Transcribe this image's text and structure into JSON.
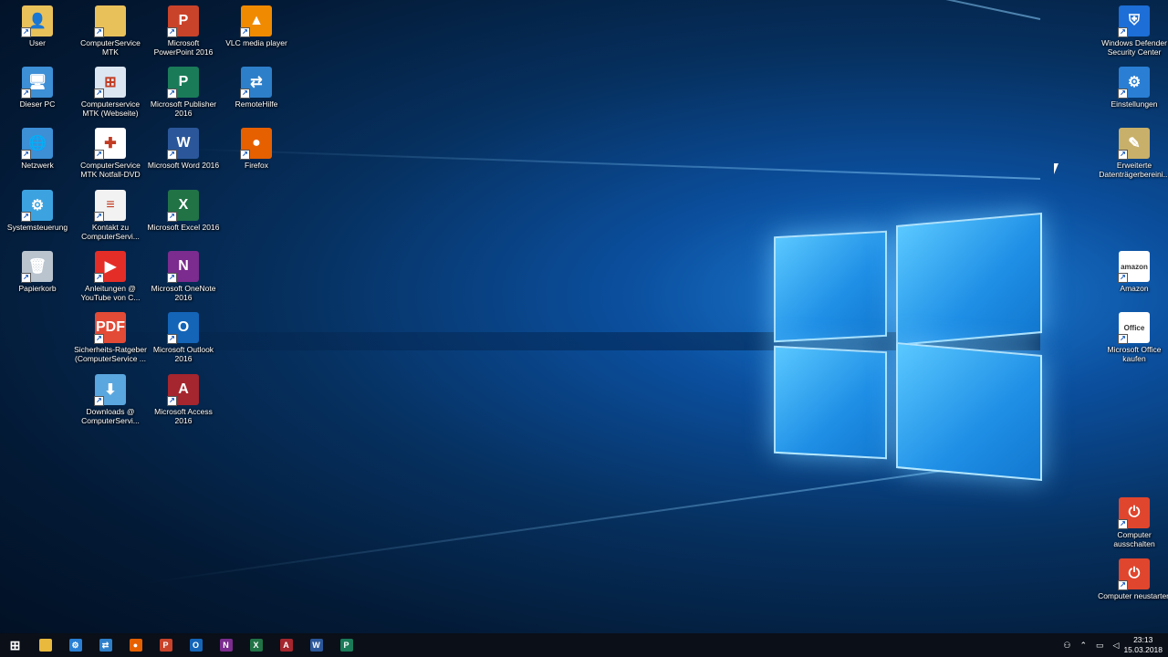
{
  "desktop_left": [
    {
      "label": "User",
      "icon": "user-folder-icon",
      "color": "#e9c15b",
      "glyph": "👤"
    },
    {
      "label": "Dieser PC",
      "icon": "computer-icon",
      "color": "#3d8fd6",
      "glyph": "🖥"
    },
    {
      "label": "Netzwerk",
      "icon": "network-globe-icon",
      "color": "#3d8fd6",
      "glyph": "🌐"
    },
    {
      "label": "Systemsteuerung",
      "icon": "control-panel-icon",
      "color": "#3da3e0",
      "glyph": "⚙"
    },
    {
      "label": "Papierkorb",
      "icon": "recycle-bin-icon",
      "color": "#b9c4cf",
      "glyph": "🗑"
    }
  ],
  "desktop_col2": [
    {
      "label": "ComputerService MTK",
      "icon": "folder-icon",
      "color": "#e9c15b",
      "glyph": ""
    },
    {
      "label": "Computerservice MTK (Webseite)",
      "icon": "web-window-icon",
      "color": "#dbe6f2",
      "glyph": "⊞"
    },
    {
      "label": "ComputerService MTK Notfall-DVD",
      "icon": "red-cross-icon",
      "color": "#ffffff",
      "glyph": "✚"
    },
    {
      "label": "Kontakt zu ComputerServi...",
      "icon": "text-document-icon",
      "color": "#f2f2f2",
      "glyph": "≡"
    },
    {
      "label": "Anleitungen @ YouTube von C...",
      "icon": "youtube-icon",
      "color": "#e52d27",
      "glyph": "▶"
    },
    {
      "label": "Sicherheits-Ratgeber (ComputerService ...",
      "icon": "pdf-document-icon",
      "color": "#e34b37",
      "glyph": "PDF"
    },
    {
      "label": "Downloads @ ComputerServi...",
      "icon": "download-icon",
      "color": "#5aa6de",
      "glyph": "⬇"
    }
  ],
  "desktop_col3": [
    {
      "label": "Microsoft PowerPoint 2016",
      "icon": "powerpoint-icon",
      "color": "#c9432a",
      "glyph": "P"
    },
    {
      "label": "Microsoft Publisher 2016",
      "icon": "publisher-icon",
      "color": "#1a7b59",
      "glyph": "P"
    },
    {
      "label": "Microsoft Word 2016",
      "icon": "word-icon",
      "color": "#2b579a",
      "glyph": "W"
    },
    {
      "label": "Microsoft Excel 2016",
      "icon": "excel-icon",
      "color": "#217346",
      "glyph": "X"
    },
    {
      "label": "Microsoft OneNote 2016",
      "icon": "onenote-icon",
      "color": "#7b2c8e",
      "glyph": "N"
    },
    {
      "label": "Microsoft Outlook 2016",
      "icon": "outlook-icon",
      "color": "#1465b8",
      "glyph": "O"
    },
    {
      "label": "Microsoft Access 2016",
      "icon": "access-icon",
      "color": "#a5262e",
      "glyph": "A"
    }
  ],
  "desktop_col4": [
    {
      "label": "VLC media player",
      "icon": "vlc-cone-icon",
      "color": "#f08a00",
      "glyph": "▲"
    },
    {
      "label": "RemoteHilfe",
      "icon": "remote-help-icon",
      "color": "#2e7fc9",
      "glyph": "⇄"
    },
    {
      "label": "Firefox",
      "icon": "firefox-icon",
      "color": "#e66000",
      "glyph": "●"
    }
  ],
  "desktop_right": [
    {
      "label": "Windows Defender Security Center",
      "icon": "shield-icon",
      "color": "#1d6ed6",
      "glyph": "⛨"
    },
    {
      "label": "Einstellungen",
      "icon": "gear-icon",
      "color": "#2a7fd4",
      "glyph": "⚙"
    },
    {
      "label": "Erweiterte Datenträgerbereini...",
      "icon": "disk-cleanup-icon",
      "color": "#c8b06a",
      "glyph": "✎"
    },
    {
      "label": "Amazon",
      "icon": "amazon-icon",
      "color": "#ffffff",
      "glyph": "amazon"
    },
    {
      "label": "Microsoft Office kaufen",
      "icon": "office-icon",
      "color": "#ffffff",
      "glyph": "Office"
    },
    {
      "label": "Computer ausschalten",
      "icon": "power-off-icon",
      "color": "#e0462d",
      "glyph": "⏻"
    },
    {
      "label": "Computer neustarten",
      "icon": "restart-icon",
      "color": "#e0462d",
      "glyph": "⏻"
    }
  ],
  "taskbar": {
    "pinned": [
      {
        "name": "start-button",
        "icon": "windows-logo-icon",
        "color": "#0a0f18",
        "glyph": "⊞"
      },
      {
        "name": "file-explorer",
        "icon": "folder-icon",
        "color": "#e9b93d",
        "glyph": ""
      },
      {
        "name": "settings",
        "icon": "gear-icon",
        "color": "#2a7fd4",
        "glyph": "⚙"
      },
      {
        "name": "remote-help",
        "icon": "remote-help-icon",
        "color": "#2e7fc9",
        "glyph": "⇄"
      },
      {
        "name": "firefox",
        "icon": "firefox-icon",
        "color": "#e66000",
        "glyph": "●"
      },
      {
        "name": "powerpoint",
        "icon": "powerpoint-icon",
        "color": "#c9432a",
        "glyph": "P"
      },
      {
        "name": "outlook",
        "icon": "outlook-icon",
        "color": "#1465b8",
        "glyph": "O"
      },
      {
        "name": "onenote",
        "icon": "onenote-icon",
        "color": "#7b2c8e",
        "glyph": "N"
      },
      {
        "name": "excel",
        "icon": "excel-icon",
        "color": "#217346",
        "glyph": "X"
      },
      {
        "name": "access",
        "icon": "access-icon",
        "color": "#a5262e",
        "glyph": "A"
      },
      {
        "name": "word",
        "icon": "word-icon",
        "color": "#2b579a",
        "glyph": "W"
      },
      {
        "name": "publisher",
        "icon": "publisher-icon",
        "color": "#1a7b59",
        "glyph": "P"
      }
    ],
    "time": "23:13",
    "date": "15.03.2018"
  }
}
